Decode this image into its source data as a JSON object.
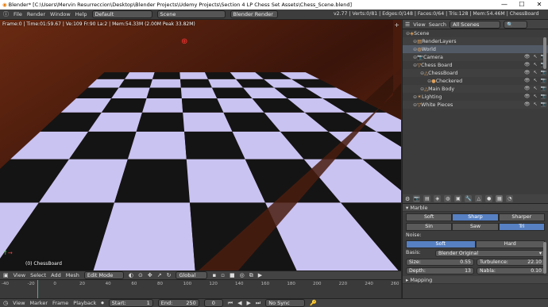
{
  "window": {
    "title": "Blender* [C:\\Users\\Mervin Resurreccion\\Desktop\\Blender Projects\\Udemy Projects\\Section 4 LP Chess Set Assets\\Chess_Scene.blend]",
    "controls": [
      "—",
      "☐",
      "✕"
    ]
  },
  "info_header": {
    "menus": [
      "File",
      "Render",
      "Window",
      "Help"
    ],
    "layout": "Default",
    "scene": "Scene",
    "engine": "Blender Render",
    "stats": "v2.77 | Verts:0/81 | Edges:0/148 | Faces:0/64 | Tris:128 | Mem:54.46M | ChessBoard"
  },
  "viewport": {
    "info_text": "Frame:0 | Time:01:59.67 | Ve:109 Fr:90 La:2 | Mem:54.33M (2.00M Peak 33.82M)",
    "object_label": "(0) ChessBoard",
    "colors": {
      "light": "#c9c3f2",
      "dark": "#141414",
      "wood": "#4a1c0e"
    }
  },
  "viewport_header": {
    "menus": [
      "View",
      "Select",
      "Add",
      "Mesh"
    ],
    "mode": "Edit Mode",
    "pivot": "Global"
  },
  "timeline": {
    "ticks": [
      "-40",
      "-20",
      "0",
      "20",
      "40",
      "60",
      "80",
      "100",
      "120",
      "140",
      "160",
      "180",
      "200",
      "220",
      "240",
      "260"
    ]
  },
  "timeline_header": {
    "menus": [
      "View",
      "Marker",
      "Frame",
      "Playback"
    ],
    "start_label": "Start:",
    "start_value": "1",
    "end_label": "End:",
    "end_value": "250",
    "current": "0",
    "sync": "No Sync"
  },
  "outliner": {
    "menus": [
      "View",
      "Search"
    ],
    "filter": "All Scenes",
    "rows": [
      {
        "label": "Scene",
        "indent": 0,
        "icon": "scene-icon"
      },
      {
        "label": "RenderLayers",
        "indent": 1,
        "icon": "renderlayers-icon"
      },
      {
        "label": "World",
        "indent": 1,
        "icon": "world-icon",
        "selected": true
      },
      {
        "label": "Camera",
        "indent": 1,
        "icon": "camera-icon"
      },
      {
        "label": "Chess Board",
        "indent": 1,
        "icon": "object-icon"
      },
      {
        "label": "ChessBoard",
        "indent": 2,
        "icon": "mesh-icon"
      },
      {
        "label": "Checkered",
        "indent": 3,
        "icon": "material-icon"
      },
      {
        "label": "Main Body",
        "indent": 2,
        "icon": "mesh-icon"
      },
      {
        "label": "Lighting",
        "indent": 1,
        "icon": "lamp-icon"
      },
      {
        "label": "White Pieces",
        "indent": 1,
        "icon": "object-icon"
      }
    ]
  },
  "properties": {
    "section_marble": "Marble",
    "row1": [
      "Soft",
      "Sharp",
      "Sharper"
    ],
    "row1_active": 1,
    "row2": [
      "Sin",
      "Saw",
      "Tri"
    ],
    "row2_active": 2,
    "noise_label": "Noise:",
    "row3": [
      "Soft",
      "Hard"
    ],
    "row3_active": 0,
    "basis_label": "Basis:",
    "basis_value": "Blender Original",
    "size_label": "Size:",
    "size_value": "0.55",
    "turbulence_label": "Turbulence:",
    "turbulence_value": "22.10",
    "depth_label": "Depth:",
    "depth_value": "13",
    "nabla_label": "Nabla:",
    "nabla_value": "0.10",
    "section_mapping": "Mapping"
  }
}
